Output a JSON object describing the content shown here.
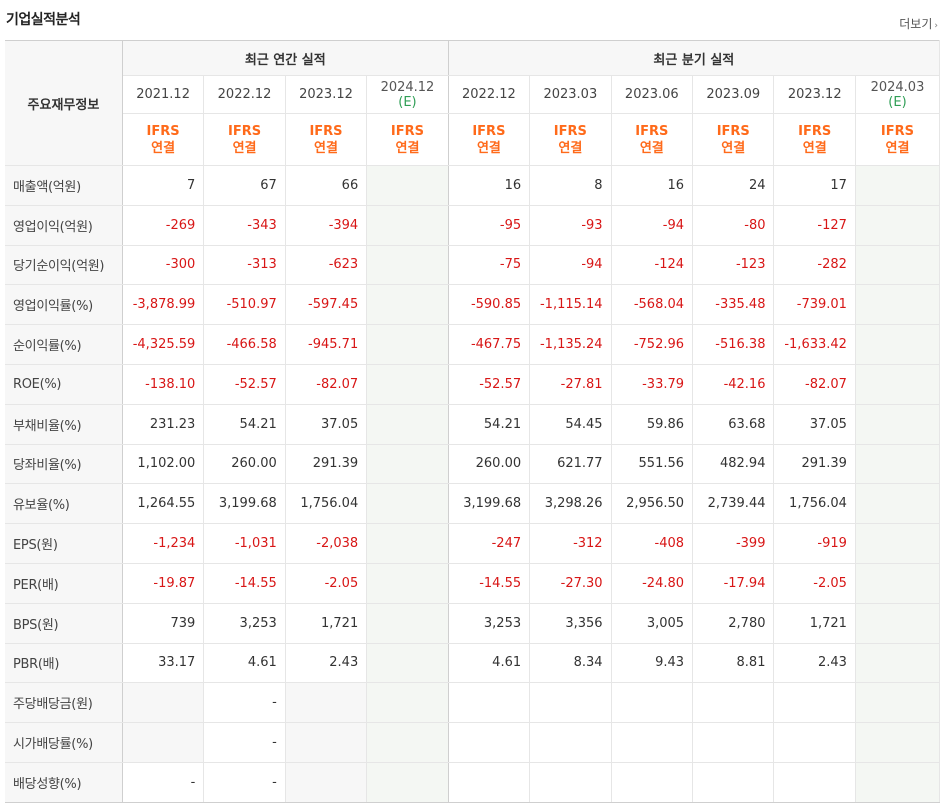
{
  "title": "기업실적분석",
  "more_label": "더보기",
  "label_header": "주요재무정보",
  "groups": [
    {
      "label": "최근 연간 실적",
      "span": 4
    },
    {
      "label": "최근 분기 실적",
      "span": 6
    }
  ],
  "periods": [
    {
      "date": "2021.12",
      "est": ""
    },
    {
      "date": "2022.12",
      "est": ""
    },
    {
      "date": "2023.12",
      "est": ""
    },
    {
      "date": "2024.12",
      "est": "(E)"
    },
    {
      "date": "2022.12",
      "est": ""
    },
    {
      "date": "2023.03",
      "est": ""
    },
    {
      "date": "2023.06",
      "est": ""
    },
    {
      "date": "2023.09",
      "est": ""
    },
    {
      "date": "2023.12",
      "est": ""
    },
    {
      "date": "2024.03",
      "est": "(E)"
    }
  ],
  "basis_top": "IFRS",
  "basis_bottom": "연결",
  "rows": [
    {
      "label": "매출액(억원)",
      "values": [
        "7",
        "67",
        "66",
        "",
        "16",
        "8",
        "16",
        "24",
        "17",
        ""
      ]
    },
    {
      "label": "영업이익(억원)",
      "values": [
        "-269",
        "-343",
        "-394",
        "",
        "-95",
        "-93",
        "-94",
        "-80",
        "-127",
        ""
      ]
    },
    {
      "label": "당기순이익(억원)",
      "values": [
        "-300",
        "-313",
        "-623",
        "",
        "-75",
        "-94",
        "-124",
        "-123",
        "-282",
        ""
      ]
    },
    {
      "label": "영업이익률(%)",
      "values": [
        "-3,878.99",
        "-510.97",
        "-597.45",
        "",
        "-590.85",
        "-1,115.14",
        "-568.04",
        "-335.48",
        "-739.01",
        ""
      ]
    },
    {
      "label": "순이익률(%)",
      "values": [
        "-4,325.59",
        "-466.58",
        "-945.71",
        "",
        "-467.75",
        "-1,135.24",
        "-752.96",
        "-516.38",
        "-1,633.42",
        ""
      ]
    },
    {
      "label": "ROE(%)",
      "values": [
        "-138.10",
        "-52.57",
        "-82.07",
        "",
        "-52.57",
        "-27.81",
        "-33.79",
        "-42.16",
        "-82.07",
        ""
      ]
    },
    {
      "label": "부채비율(%)",
      "values": [
        "231.23",
        "54.21",
        "37.05",
        "",
        "54.21",
        "54.45",
        "59.86",
        "63.68",
        "37.05",
        ""
      ]
    },
    {
      "label": "당좌비율(%)",
      "values": [
        "1,102.00",
        "260.00",
        "291.39",
        "",
        "260.00",
        "621.77",
        "551.56",
        "482.94",
        "291.39",
        ""
      ]
    },
    {
      "label": "유보율(%)",
      "values": [
        "1,264.55",
        "3,199.68",
        "1,756.04",
        "",
        "3,199.68",
        "3,298.26",
        "2,956.50",
        "2,739.44",
        "1,756.04",
        ""
      ]
    },
    {
      "label": "EPS(원)",
      "values": [
        "-1,234",
        "-1,031",
        "-2,038",
        "",
        "-247",
        "-312",
        "-408",
        "-399",
        "-919",
        ""
      ]
    },
    {
      "label": "PER(배)",
      "values": [
        "-19.87",
        "-14.55",
        "-2.05",
        "",
        "-14.55",
        "-27.30",
        "-24.80",
        "-17.94",
        "-2.05",
        ""
      ]
    },
    {
      "label": "BPS(원)",
      "values": [
        "739",
        "3,253",
        "1,721",
        "",
        "3,253",
        "3,356",
        "3,005",
        "2,780",
        "1,721",
        ""
      ]
    },
    {
      "label": "PBR(배)",
      "values": [
        "33.17",
        "4.61",
        "2.43",
        "",
        "4.61",
        "8.34",
        "9.43",
        "8.81",
        "2.43",
        ""
      ]
    },
    {
      "label": "주당배당금(원)",
      "values": [
        "",
        "-",
        "",
        "",
        "",
        "",
        "",
        "",
        "",
        ""
      ]
    },
    {
      "label": "시가배당률(%)",
      "values": [
        "",
        "-",
        "",
        "",
        "",
        "",
        "",
        "",
        "",
        ""
      ]
    },
    {
      "label": "배당성향(%)",
      "values": [
        "-",
        "-",
        "",
        "",
        "",
        "",
        "",
        "",
        "",
        ""
      ]
    }
  ],
  "colors": {
    "negative": "#d81616",
    "basis": "#ff6a1a",
    "estimate_bg": "#f4f7f3",
    "label_bg": "#f7f7f7"
  }
}
